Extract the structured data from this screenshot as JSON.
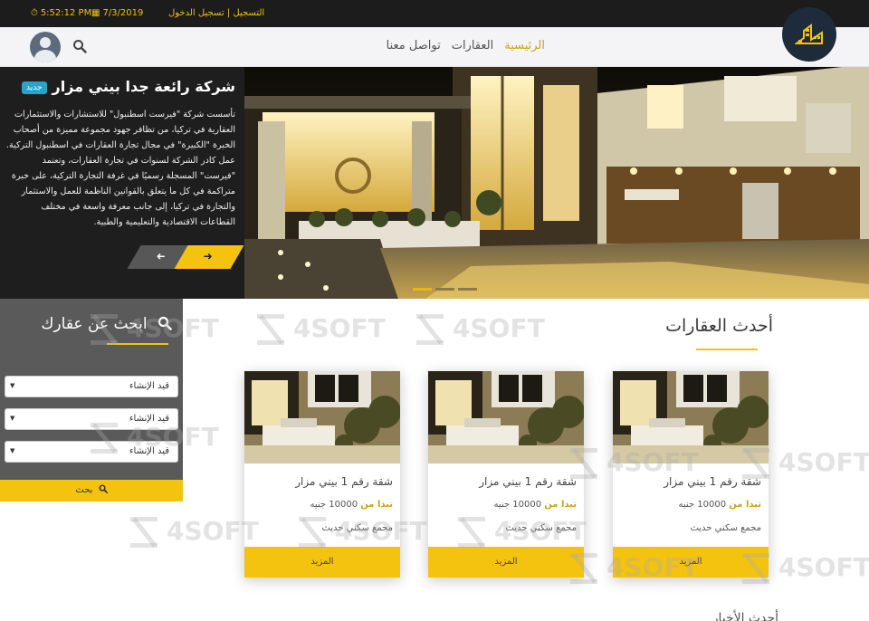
{
  "topbar": {
    "time": "5:52:12 PM",
    "date": "7/3/2019",
    "login": "تسجيل الدخول",
    "separator": "|",
    "register": "التسجيل",
    "icons": {
      "time": "clock-icon",
      "date": "calendar-icon"
    }
  },
  "nav": {
    "menu": [
      "الرئيسية",
      "العقارات",
      "تواصل معنا"
    ],
    "active_index": 0,
    "icons": {
      "search": "search-icon",
      "user": "user-avatar",
      "logo": "buildings-logo"
    }
  },
  "hero": {
    "badge": "جديد",
    "title": "شركة رائعة جدا بيني مزار",
    "text": "تأسست شركة \"فيرست اسطنبول\" للاستشارات والاستثمارات العقارية في تركيا، من تظافر جهود مجموعة مميزة من أصحاب الخبرة \"الكبيرة\" في مجال تجارة العقارات في اسطنبول التركية. عمل كادر الشركة لسنوات في تجارة العقارات، وتعتمد \"فيرست\" المسجلة رسميًا في غرفة التجارة التركية، على خبرة متراكمة في كل ما يتعلق بالقوانين الناظمة للعمل والاستثمار والتجارة في تركيا، إلى جانب معرفة واسعة في مختلف القطاعات الاقتصادية والتعليمية والطبية.",
    "arrows": {
      "next": "➜",
      "prev": "➜"
    },
    "slides": 3,
    "active_slide": 0
  },
  "search_panel": {
    "title": "ابحث عن عقارك",
    "selects": [
      "قيد الإنشاء",
      "قيد الإنشاء",
      "قيد الإنشاء"
    ],
    "button": "بحث",
    "icons": {
      "title": "search-icon",
      "button": "search-icon",
      "select": "caret-down-icon"
    }
  },
  "main": {
    "section_title": "أحدث العقارات",
    "cards": [
      {
        "title": "شقة رقم 1 بيني مزار",
        "from_label": "تبدا من",
        "price": "10000",
        "currency": "جنيه",
        "subtitle": "مجمع سكني حديث",
        "button": "المزيد"
      },
      {
        "title": "شقة رقم 1 بيني مزار",
        "from_label": "تبدا من",
        "price": "10000",
        "currency": "جنيه",
        "subtitle": "مجمع سكني حديث",
        "button": "المزيد"
      },
      {
        "title": "شقة رقم 1 بيني مزار",
        "from_label": "تبدا من",
        "price": "10000",
        "currency": "جنيه",
        "subtitle": "مجمع سكني حديث",
        "button": "المزيد"
      }
    ],
    "watermark": "4SOFT",
    "next_section_partial": "أحدث الأخبار"
  },
  "colors": {
    "accent": "#f4c30f",
    "dark": "#1c1c1c",
    "panel": "#5a5a5a",
    "badge": "#2aa3c9",
    "logo_bg": "#1d2b3a"
  }
}
